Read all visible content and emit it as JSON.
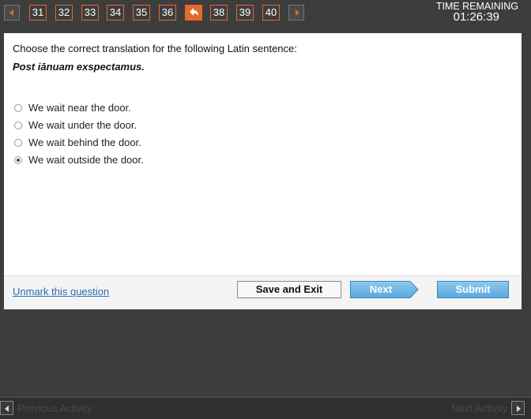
{
  "nav": {
    "questions_before": [
      "31",
      "32",
      "33",
      "34",
      "35",
      "36"
    ],
    "questions_after": [
      "38",
      "39",
      "40"
    ]
  },
  "timer": {
    "label": "TIME REMAINING",
    "value": "01:26:39"
  },
  "question": {
    "prompt": "Choose the correct translation for the following Latin sentence:",
    "sentence": "Post iānuam exspectamus.",
    "options": [
      {
        "label": "We wait near the door.",
        "selected": false
      },
      {
        "label": "We wait under the door.",
        "selected": false
      },
      {
        "label": "We wait behind the door.",
        "selected": false
      },
      {
        "label": "We wait outside the door.",
        "selected": true
      }
    ]
  },
  "footer": {
    "unmark_label": "Unmark this question",
    "save_label": "Save and Exit",
    "next_label": "Next",
    "submit_label": "Submit"
  },
  "bottom": {
    "prev_label": "Previous Activity",
    "next_label": "Next Activity"
  },
  "colors": {
    "accent": "#e36a2a",
    "button_blue": "#5aa8dc",
    "link": "#2a6db5"
  }
}
